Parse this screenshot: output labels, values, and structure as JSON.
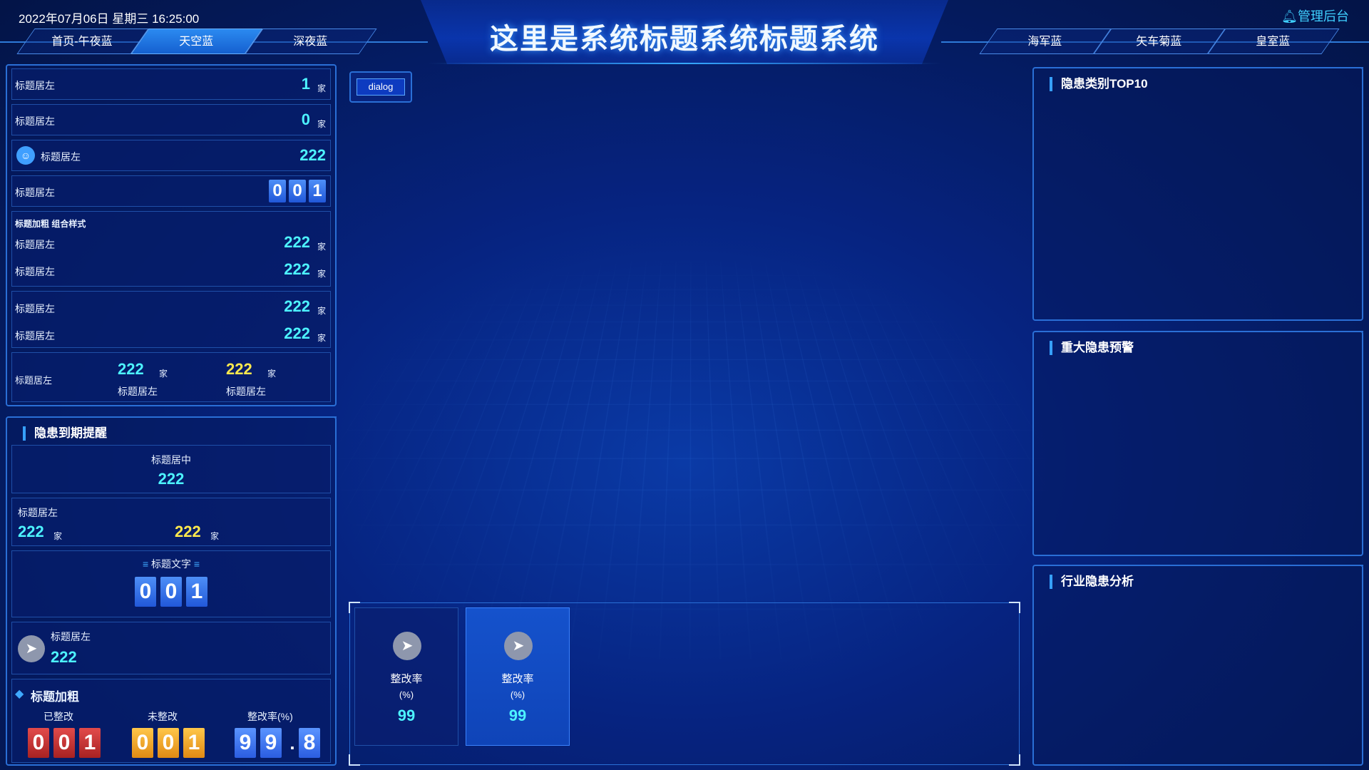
{
  "header": {
    "datetime": "2022年07月06日 星期三 16:25:00",
    "title": "这里是系统标题系统标题系统",
    "admin": "管理后台",
    "tabs_left": [
      "首页-午夜蓝",
      "天空蓝",
      "深夜蓝"
    ],
    "tabs_right": [
      "海军蓝",
      "矢车菊蓝",
      "皇室蓝"
    ],
    "active_tab": "天空蓝"
  },
  "left_top": {
    "rows": [
      {
        "label": "标题居左",
        "value": "1",
        "unit": "家"
      },
      {
        "label": "标题居左",
        "value": "0",
        "unit": "家"
      },
      {
        "label": "标题居左",
        "value": "222"
      },
      {
        "label": "标题居左",
        "digits": [
          "0",
          "0",
          "1"
        ]
      }
    ],
    "group_title": "标题加粗 组合样式",
    "group1": [
      {
        "label": "标题居左",
        "value": "222",
        "unit": "家"
      },
      {
        "label": "标题居左",
        "value": "222",
        "unit": "家"
      }
    ],
    "group2": [
      {
        "label": "标题居左",
        "value": "222",
        "unit": "家"
      },
      {
        "label": "标题居左",
        "value": "222",
        "unit": "家"
      }
    ],
    "last": {
      "label": "标题居左",
      "a": {
        "value": "222",
        "unit": "家",
        "caption": "标题居左"
      },
      "b": {
        "value": "222",
        "unit": "家",
        "caption": "标题居左"
      }
    }
  },
  "left_bottom": {
    "title": "隐患到期提醒",
    "center": {
      "label": "标题居中",
      "value": "222"
    },
    "pair": {
      "label": "标题居左",
      "a": "222",
      "b": "222",
      "unit": "家"
    },
    "text_block": {
      "label": "标题文字",
      "digits": [
        "0",
        "0",
        "1"
      ]
    },
    "icon_row": {
      "label": "标题居左",
      "value": "222"
    },
    "stats": {
      "title": "标题加粗",
      "col1": {
        "label": "已整改",
        "digits": [
          "0",
          "0",
          "1"
        ]
      },
      "col2": {
        "label": "未整改",
        "digits": [
          "0",
          "0",
          "1"
        ]
      },
      "col3": {
        "label": "整改率(%)",
        "digits": [
          "9",
          "9",
          ".",
          "8"
        ]
      }
    }
  },
  "center": {
    "dialog_label": "dialog",
    "cards": [
      {
        "label": "整改率",
        "unit": "(%)",
        "value": "99"
      },
      {
        "label": "整改率",
        "unit": "(%)",
        "value": "99"
      }
    ]
  },
  "right": {
    "panel1_title": "隐患类别TOP10",
    "panel2_title": "重大隐患预警",
    "panel3_title": "行业隐患分析"
  }
}
